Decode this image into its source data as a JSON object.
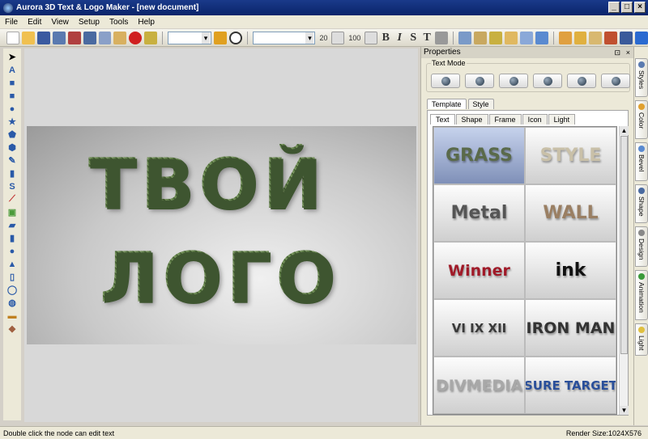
{
  "window": {
    "title": "Aurora 3D Text & Logo Maker - [new document]",
    "buttons": [
      "_",
      "□",
      "×"
    ]
  },
  "menu": [
    "File",
    "Edit",
    "View",
    "Setup",
    "Tools",
    "Help"
  ],
  "toolbar": {
    "font_size": "20",
    "scale": "100",
    "text_buttons": [
      "B",
      "I",
      "S",
      "T"
    ]
  },
  "canvas": {
    "line1": "ТВОЙ",
    "line2": "ЛОГО"
  },
  "properties": {
    "title": "Properties",
    "pin": "⊡",
    "close": "×",
    "text_mode_label": "Text Mode",
    "tabs": [
      "Template",
      "Style"
    ],
    "subtabs": [
      "Text",
      "Shape",
      "Frame",
      "Icon",
      "Light"
    ],
    "templates": [
      {
        "label": "GRASS",
        "color": "#5a6a4a",
        "selected": true
      },
      {
        "label": "STYLE",
        "color": "#c9c0a8"
      },
      {
        "label": "Metal",
        "color": "#555555"
      },
      {
        "label": "WALL",
        "color": "#9a7f63"
      },
      {
        "label": "Winner",
        "color": "#a01a28"
      },
      {
        "label": "ink",
        "color": "#111111"
      },
      {
        "label": "VI IX XII",
        "color": "#3a3a3a"
      },
      {
        "label": "IRON MAN",
        "color": "#333333"
      },
      {
        "label": "DIVMEDIA",
        "color": "#a8a8a8"
      },
      {
        "label": "SURE TARGET",
        "color": "#2a4f9a"
      }
    ]
  },
  "side_tabs": [
    "Styles",
    "Color",
    "Bevel",
    "Shape",
    "Design",
    "Animation",
    "Light"
  ],
  "status": {
    "left": "Double click the node can edit text",
    "right": "Render Size:1024X576"
  }
}
